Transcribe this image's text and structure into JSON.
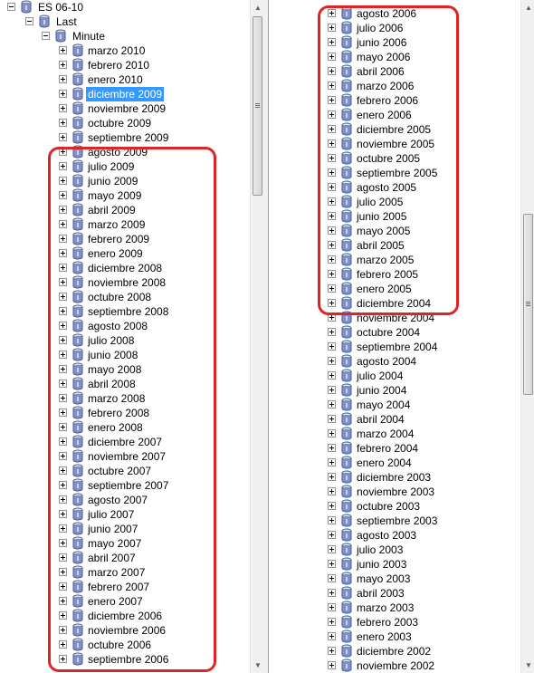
{
  "left_tree": {
    "root_label": "ES 06-10",
    "child_label": "Last",
    "grandchild_label": "Minute",
    "items": [
      "marzo 2010",
      "febrero 2010",
      "enero 2010",
      "diciembre 2009",
      "noviembre 2009",
      "octubre 2009",
      "septiembre 2009",
      "agosto 2009",
      "julio 2009",
      "junio 2009",
      "mayo 2009",
      "abril 2009",
      "marzo 2009",
      "febrero 2009",
      "enero 2009",
      "diciembre 2008",
      "noviembre 2008",
      "octubre 2008",
      "septiembre 2008",
      "agosto 2008",
      "julio 2008",
      "junio 2008",
      "mayo 2008",
      "abril 2008",
      "marzo 2008",
      "febrero 2008",
      "enero 2008",
      "diciembre 2007",
      "noviembre 2007",
      "octubre 2007",
      "septiembre 2007",
      "agosto 2007",
      "julio 2007",
      "junio 2007",
      "mayo 2007",
      "abril 2007",
      "marzo 2007",
      "febrero 2007",
      "enero 2007",
      "diciembre 2006",
      "noviembre 2006",
      "octubre 2006",
      "septiembre 2006"
    ],
    "selected_item": "diciembre 2009",
    "scroll_position": 0.0
  },
  "right_tree": {
    "items": [
      "agosto 2006",
      "julio 2006",
      "junio 2006",
      "mayo 2006",
      "abril 2006",
      "marzo 2006",
      "febrero 2006",
      "enero 2006",
      "diciembre 2005",
      "noviembre 2005",
      "octubre 2005",
      "septiembre 2005",
      "agosto 2005",
      "julio 2005",
      "junio 2005",
      "mayo 2005",
      "abril 2005",
      "marzo 2005",
      "febrero 2005",
      "enero 2005",
      "diciembre 2004",
      "noviembre 2004",
      "octubre 2004",
      "septiembre 2004",
      "agosto 2004",
      "julio 2004",
      "junio 2004",
      "mayo 2004",
      "abril 2004",
      "marzo 2004",
      "febrero 2004",
      "enero 2004",
      "diciembre 2003",
      "noviembre 2003",
      "octubre 2003",
      "septiembre 2003",
      "agosto 2003",
      "julio 2003",
      "junio 2003",
      "mayo 2003",
      "abril 2003",
      "marzo 2003",
      "febrero 2003",
      "enero 2003",
      "diciembre 2002",
      "noviembre 2002"
    ],
    "scroll_position": 0.45
  },
  "icons": {
    "expander": "plus-expander-icon",
    "collapser": "minus-expander-icon",
    "node": "database-cylinder-icon"
  },
  "colors": {
    "selection": "#3399ff",
    "highlight_border": "#e02424",
    "db_icon": "#8090c8"
  }
}
